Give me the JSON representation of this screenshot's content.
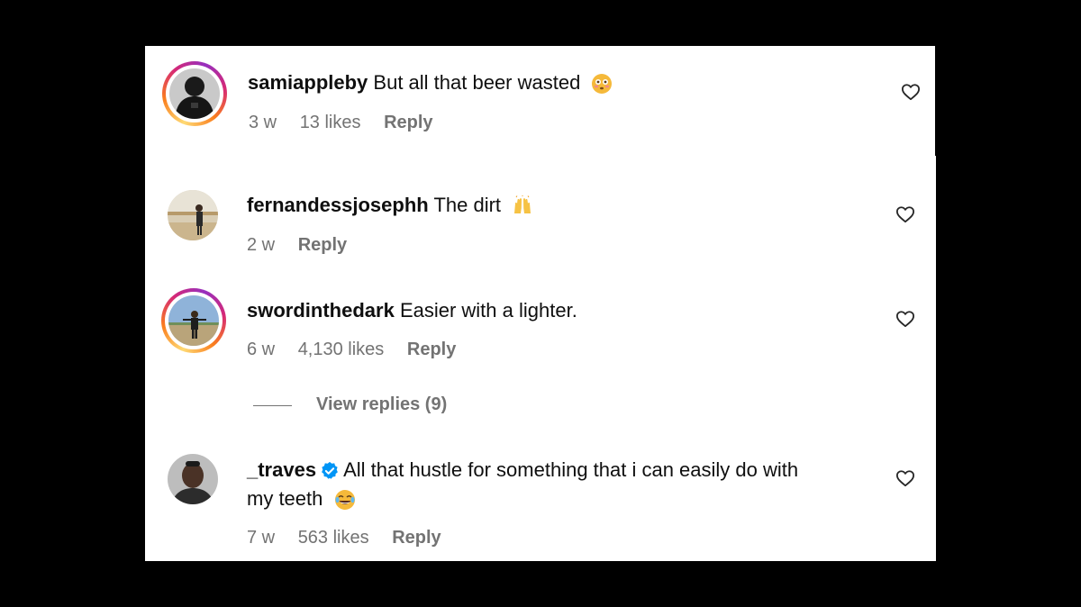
{
  "comments": [
    {
      "username": "samiappleby",
      "text": "But all that beer wasted",
      "emoji": "flushed-face",
      "time": "3 w",
      "likes": "13 likes",
      "reply_label": "Reply",
      "story_ring": true
    },
    {
      "username": "fernandessjosephh",
      "text": "The dirt",
      "emoji": "raising-hands",
      "time": "2 w",
      "reply_label": "Reply",
      "story_ring": false
    },
    {
      "username": "swordinthedark",
      "text": "Easier with a lighter.",
      "time": "6 w",
      "likes": "4,130 likes",
      "reply_label": "Reply",
      "story_ring": true,
      "view_replies": "View replies (9)"
    },
    {
      "username": "_traves",
      "verified": true,
      "text_line1": "All that hustle for something that i can easily do with",
      "text_line2": "my teeth",
      "emoji": "face-with-tears-of-joy",
      "time": "7 w",
      "likes": "563 likes",
      "reply_label": "Reply",
      "story_ring": false
    }
  ],
  "colors": {
    "background": "#000000",
    "panel": "#ffffff",
    "text": "#0f0f0f",
    "muted": "#737373",
    "verified": "#0095f6"
  }
}
